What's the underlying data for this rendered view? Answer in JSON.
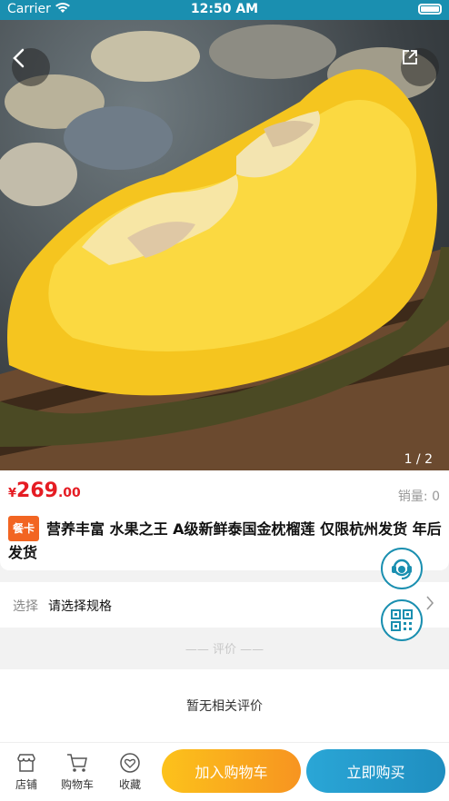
{
  "status_bar": {
    "carrier": "Carrier",
    "time": "12:50 AM"
  },
  "gallery": {
    "counter": "1 / 2"
  },
  "product": {
    "price_symbol": "¥",
    "price_integer": "269",
    "price_decimal": ".00",
    "sales": "销量: 0",
    "badge": "餐卡",
    "title": "营养丰富 水果之王 A级新鲜泰国金枕榴莲 仅限杭州发货 年后发货"
  },
  "spec": {
    "label": "选择",
    "value": "请选择规格"
  },
  "reviews": {
    "header": "—— 评价 ——",
    "empty": "暂无相关评价"
  },
  "bottom_nav": {
    "store": "店铺",
    "cart": "购物车",
    "favorite": "收藏",
    "add_to_cart": "加入购物车",
    "buy_now": "立即购买"
  },
  "colors": {
    "status_bar": "#1a8fb0",
    "price": "#e51c23",
    "badge": "#f26522",
    "cart_button": "#f79420",
    "buy_button": "#1f8ec0"
  }
}
